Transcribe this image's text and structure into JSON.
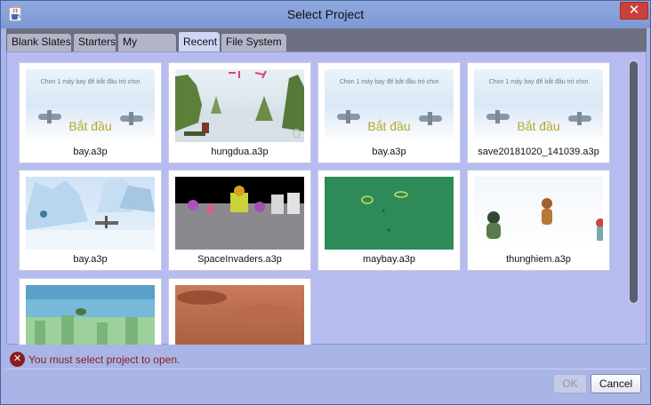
{
  "window": {
    "title": "Select Project",
    "close_glyph": "✕",
    "app_icon": "java-cup-icon"
  },
  "tabs": [
    {
      "label": "Blank Slates",
      "active": false
    },
    {
      "label": "Starters",
      "active": false
    },
    {
      "label": "My Projects",
      "active": false
    },
    {
      "label": "Recent",
      "active": true
    },
    {
      "label": "File System",
      "active": false
    }
  ],
  "projects": [
    {
      "name": "bay.a3p",
      "thumb": {
        "caption": "Chon 1 máy bay để bắt đầu trò chơi",
        "title": "Bắt đầu"
      }
    },
    {
      "name": "hungdua.a3p",
      "thumb": {
        "counter": "0"
      }
    },
    {
      "name": "bay.a3p",
      "thumb": {
        "caption": "Chon 1 máy bay để bắt đầu trò chơi",
        "title": "Bắt đầu"
      }
    },
    {
      "name": "save20181020_141039.a3p",
      "thumb": {
        "caption": "Chon 1 máy bay để bắt đầu trò chơi",
        "title": "Bắt đầu"
      }
    },
    {
      "name": "bay.a3p"
    },
    {
      "name": "SpaceInvaders.a3p"
    },
    {
      "name": "maybay.a3p"
    },
    {
      "name": "thunghiem.a3p"
    },
    {
      "name": ""
    },
    {
      "name": ""
    }
  ],
  "status": {
    "icon": "error-icon",
    "glyph": "✕",
    "message": "You must select project to open.",
    "color": "#8a1c1c"
  },
  "buttons": {
    "ok": "OK",
    "ok_enabled": false,
    "cancel": "Cancel"
  },
  "colors": {
    "titlebar": "#7d98d4",
    "close": "#c9413a",
    "panel": "#b7bcf0",
    "tabstrip": "#6f6f82"
  }
}
